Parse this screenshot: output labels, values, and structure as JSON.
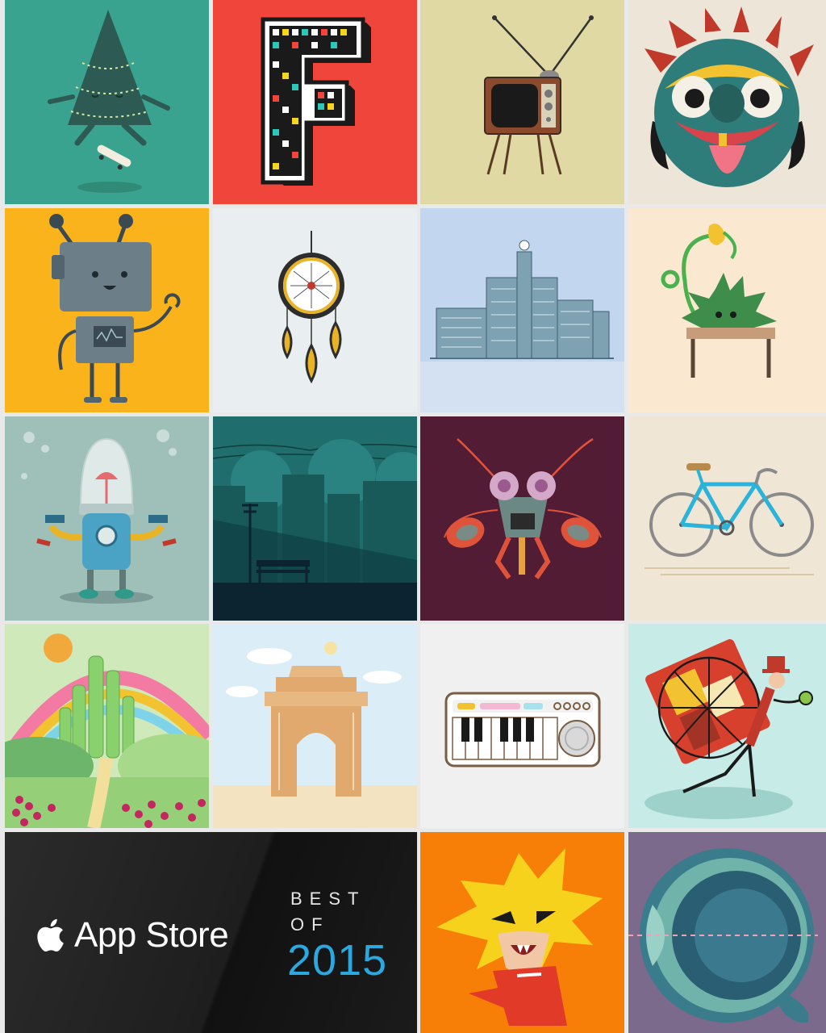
{
  "colors": {
    "tree_bg": "#3aa38f",
    "letter_bg": "#f0453b",
    "tv_bg": "#e0d9a4",
    "mask_bg": "#ece5d8",
    "robot_bg": "#fbb31c",
    "dreamcatcher_bg": "#e9eef0",
    "building_bg": "#c3d6ef",
    "plant_bg": "#fbe8d1",
    "capsule_bg": "#9fbfb9",
    "night_city_bg": "#1f6d6c",
    "insect_bg": "#521c34",
    "bicycle_bg": "#efe6d6",
    "emerald_city_bg": "#cfe9bb",
    "india_gate_bg": "#dbeef8",
    "keyboard_bg": "#f0f0f0",
    "traveler_bg": "#c7ebe7",
    "hero_bg": "#f77f07",
    "eye_bg": "#7b6a8b",
    "badge_bg": "#1e1e1e",
    "year_accent": "#2aa8e0"
  },
  "tiles": [
    {
      "icon": "christmas-tree-skateboard-icon"
    },
    {
      "icon": "pixel-letter-f-icon"
    },
    {
      "icon": "retro-tv-icon"
    },
    {
      "icon": "tribal-mask-icon"
    },
    {
      "icon": "box-robot-icon"
    },
    {
      "icon": "dreamcatcher-icon"
    },
    {
      "icon": "building-icon"
    },
    {
      "icon": "potted-plant-creature-icon"
    },
    {
      "icon": "capsule-robot-icon"
    },
    {
      "icon": "night-city-bench-icon"
    },
    {
      "icon": "insect-icon"
    },
    {
      "icon": "bicycle-icon"
    },
    {
      "icon": "emerald-city-rainbow-icon"
    },
    {
      "icon": "india-gate-icon"
    },
    {
      "icon": "keyboard-synth-icon"
    },
    {
      "icon": "traveler-backpack-icon"
    },
    {
      "icon": "spiky-hair-hero-icon"
    },
    {
      "icon": "eye-cross-section-icon"
    }
  ],
  "badge": {
    "store_name": "App Store",
    "best": "BEST",
    "of": "OF",
    "year": "2015"
  }
}
